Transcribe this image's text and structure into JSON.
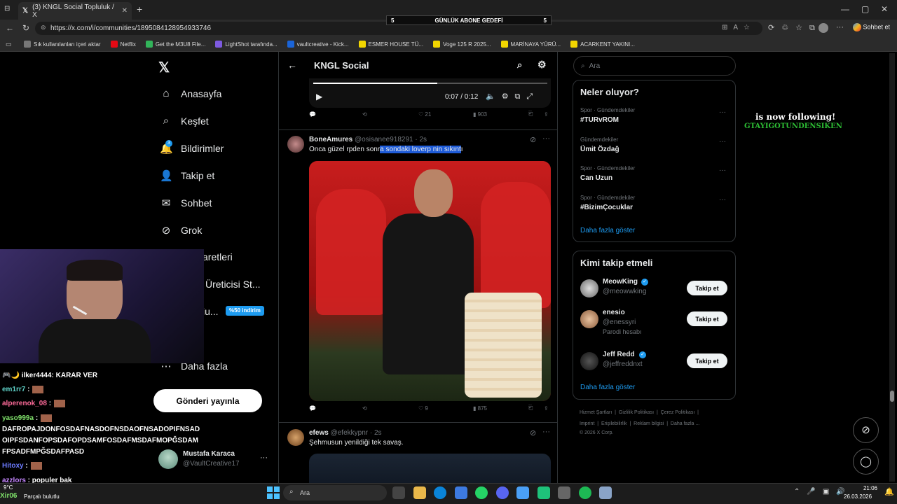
{
  "browser": {
    "tab_title": "(3) KNGL Social Topluluk / X",
    "url": "https://x.com/i/communities/1895084128954933746",
    "bookmarks": [
      "Sık kullanılanları içeri aktar",
      "Netflix",
      "Get the M3U8 File...",
      "LightShot tarafında...",
      "vaultcreative - Kick...",
      "ESMER HOUSE TÜ...",
      "Voge 125 R 2025...",
      "MARİNAYA YÜRÜ...",
      "ACARKENT YAKINI..."
    ],
    "sohbet": "Sohbet et"
  },
  "banner": {
    "left": "5",
    "label": "GÜNLÜK ABONE GEDEFİ",
    "right": "5"
  },
  "nav": {
    "items": [
      "Anasayfa",
      "Keşfet",
      "Bildirimler",
      "Takip et",
      "Sohbet",
      "Grok",
      "aretleri",
      "Üreticisi St...",
      "iu...",
      "Daha fazla"
    ],
    "badge": "3",
    "discount": "%50 indirim",
    "post_button": "Gönderi yayınla",
    "profile_name": "Mustafa Karaca",
    "profile_handle": "@VaultCreative17"
  },
  "community": {
    "title": "KNGL Social"
  },
  "video": {
    "time": "0:07 / 0:12",
    "progress": 0.53
  },
  "post0": {
    "likes": "21",
    "views": "903"
  },
  "post1": {
    "name": "BoneAmures",
    "handle": "@osisanee918291",
    "age": "· 2s",
    "text_plain": "Onca güzel rpden sonr",
    "text_sel": "a sondaki loverp nin sıkınt",
    "text_end": "ı",
    "likes": "9",
    "views": "875"
  },
  "post2": {
    "name": "efews",
    "handle": "@efekkypnr",
    "age": "· 2s",
    "text": "Şehmusun yenildiği tek savaş."
  },
  "right": {
    "search_placeholder": "Ara",
    "trends_title": "Neler oluyor?",
    "trends": [
      {
        "cat": "Spor · Gündemdekiler",
        "name": "#TURvROM"
      },
      {
        "cat": "Gündemdekiler",
        "name": "Ümit Özdağ"
      },
      {
        "cat": "Spor · Gündemdekiler",
        "name": "Can Uzun"
      },
      {
        "cat": "Spor · Gündemdekiler",
        "name": "#BizimÇocuklar"
      }
    ],
    "show_more": "Daha fazla göster",
    "who_title": "Kimi takip etmeli",
    "who": [
      {
        "name": "MeowKing",
        "handle": "@meowwking",
        "extra": ""
      },
      {
        "name": "enesio",
        "handle": "@enessyri",
        "extra": "Parodi hesabı"
      },
      {
        "name": "Jeff Redd",
        "handle": "@jeffreddnxt",
        "extra": ""
      }
    ],
    "follow_label": "Takip et",
    "footer1": "Hizmet Şartları  |  Gizlilik Politikası  |  Çerez Politikası  |",
    "footer2": "Imprint  |  Erişilebilirlik  |  Reklam bilgisi  |  Daha fazla ...",
    "footer3": "© 2026 X Corp."
  },
  "overlay": {
    "follow_line1": "is now following!",
    "follow_line2": "GTAYIGOTUNDENSIKEN"
  },
  "chat": [
    {
      "user": "ilker4444",
      "msg": ": KARAR VER",
      "color": "#ffffff"
    },
    {
      "user": "em1rr7",
      "msg": " :",
      "color": "#5fd3c9"
    },
    {
      "user": "alperenok_08",
      "msg": " :",
      "color": "#ff6b9a"
    },
    {
      "user": "yaso999a",
      "msg": " :",
      "color": "#7fe06a"
    },
    {
      "user": "",
      "msg": "DAFROPAJDONFOSDAFNASDOFNSDAOFNSADOPIFNSAD",
      "color": "#fff"
    },
    {
      "user": "",
      "msg": "OIPFSDANFOPSDAFOPDSAMFOSDAFMSDAFMOPĞSDAM",
      "color": "#fff"
    },
    {
      "user": "",
      "msg": "FPSADFMPĞSDAFPASD",
      "color": "#fff"
    },
    {
      "user": "Hitoxy",
      "msg": " :",
      "color": "#6c7bff"
    },
    {
      "user": "azzlors",
      "msg": " : populer bak",
      "color": "#c586ff"
    }
  ],
  "taskbar": {
    "search": "Ara",
    "time": "21:06",
    "date": "26.03.2026",
    "weather_temp": "9°C",
    "weather_desc": "Parçalı bulutlu",
    "weather_user": "Xir06"
  }
}
